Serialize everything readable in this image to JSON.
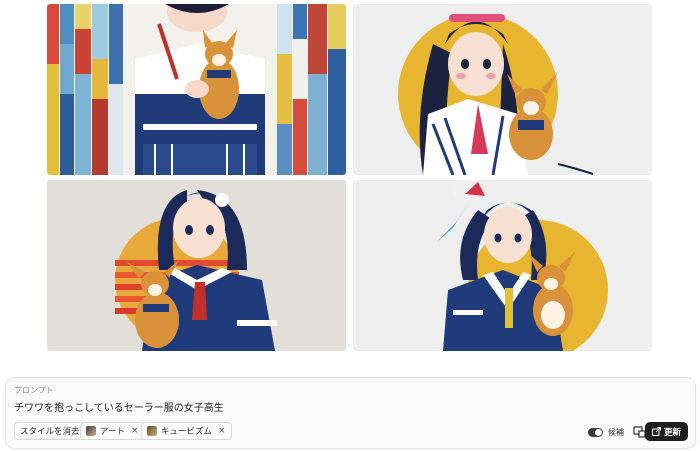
{
  "images": [
    {
      "name": "girl-chihuahua-stained-glass"
    },
    {
      "name": "girl-chihuahua-yellow-circle"
    },
    {
      "name": "girl-chihuahua-sunset"
    },
    {
      "name": "girl-chihuahua-hair-ribbon"
    }
  ],
  "prompt": {
    "label": "プロンプト",
    "text": "チワワを抱っこしているセーラー服の女子高生"
  },
  "styles": {
    "clear_label": "スタイルを消去",
    "chips": [
      {
        "label": "アート",
        "icon": "art-thumbnail"
      },
      {
        "label": "キュービズム",
        "icon": "cubism-thumbnail"
      }
    ],
    "remove_symbol": "×"
  },
  "controls": {
    "toggle_label": "候補",
    "layout_icon": "layout-icon",
    "update_label": "更新",
    "update_icon": "external-link-icon"
  },
  "colors": {
    "navy": "#1f3b7a",
    "chihuahua": "#d9923a",
    "yellow": "#e8b530",
    "button": "#1e1e1e"
  }
}
